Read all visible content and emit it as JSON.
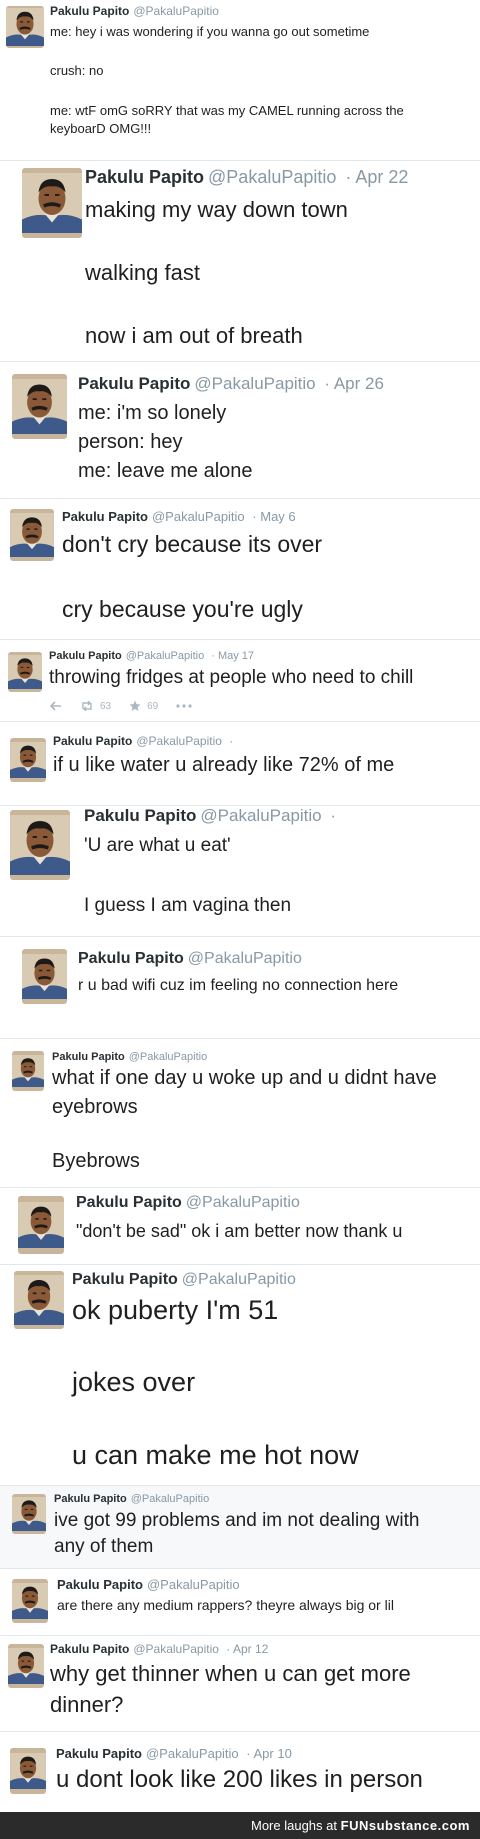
{
  "tweets": [
    {
      "name": "Pakulu Papito",
      "handle": "@PakaluPapitio",
      "date": "",
      "lines": [
        "me: hey i was wondering if you wanna go out sometime",
        "crush: no",
        "me: wtF omG soRRY that was my CAMEL running across the",
        "keyboarD OMG!!!"
      ]
    },
    {
      "name": "Pakulu Papito",
      "handle": "@PakaluPapitio",
      "date": "Apr 22",
      "lines": [
        "making my way down town",
        "walking fast",
        "now i am out of breath"
      ]
    },
    {
      "name": "Pakulu Papito",
      "handle": "@PakaluPapitio",
      "date": "Apr 26",
      "lines": [
        "me: i'm so lonely",
        "person: hey",
        "me: leave me alone"
      ]
    },
    {
      "name": "Pakulu Papito",
      "handle": "@PakaluPapitio",
      "date": "May 6",
      "lines": [
        "don't cry because its over",
        "cry because you're ugly"
      ]
    },
    {
      "name": "Pakulu Papito",
      "handle": "@PakaluPapitio",
      "date": "May 17",
      "lines": [
        "throwing fridges at people who need to chill"
      ],
      "retweets": "63",
      "favorites": "69"
    },
    {
      "name": "Pakulu Papito",
      "handle": "@PakaluPapitio",
      "date": "",
      "lines": [
        "if u like water u already like 72% of me"
      ]
    },
    {
      "name": "Pakulu Papito",
      "handle": "@PakaluPapitio",
      "date": "",
      "lines": [
        "'U are what u eat'",
        "I guess I am vagina then"
      ]
    },
    {
      "name": "Pakulu Papito",
      "handle": "@PakaluPapitio",
      "date": "",
      "lines": [
        "r u bad wifi cuz im feeling no connection here"
      ]
    },
    {
      "name": "Pakulu Papito",
      "handle": "@PakaluPapitio",
      "date": "",
      "lines": [
        "what if one day u woke up and u didnt have",
        "eyebrows",
        "Byebrows"
      ]
    },
    {
      "name": "Pakulu Papito",
      "handle": "@PakaluPapitio",
      "date": "",
      "lines": [
        "\"don't be sad\" ok i am better now thank u"
      ]
    },
    {
      "name": "Pakulu Papito",
      "handle": "@PakaluPapitio",
      "date": "",
      "lines": [
        "ok puberty I'm 51",
        "jokes over",
        "u can make me hot now"
      ]
    },
    {
      "name": "Pakulu Papito",
      "handle": "@PakaluPapitio",
      "date": "",
      "lines": [
        "ive got 99 problems and im not dealing with",
        "any of them"
      ]
    },
    {
      "name": "Pakulu Papito",
      "handle": "@PakaluPapitio",
      "date": "",
      "lines": [
        "are there any medium rappers? theyre always big or lil"
      ]
    },
    {
      "name": "Pakulu Papito",
      "handle": "@PakaluPapitio",
      "date": "Apr 12",
      "lines": [
        "why get thinner when u can get more",
        "dinner?"
      ]
    },
    {
      "name": "Pakulu Papito",
      "handle": "@PakaluPapitio",
      "date": "Apr 10",
      "lines": [
        "u dont look like 200 likes in person"
      ]
    }
  ],
  "footer": {
    "prefix": "More laughs at",
    "brand": "FUNsubstance.com"
  }
}
